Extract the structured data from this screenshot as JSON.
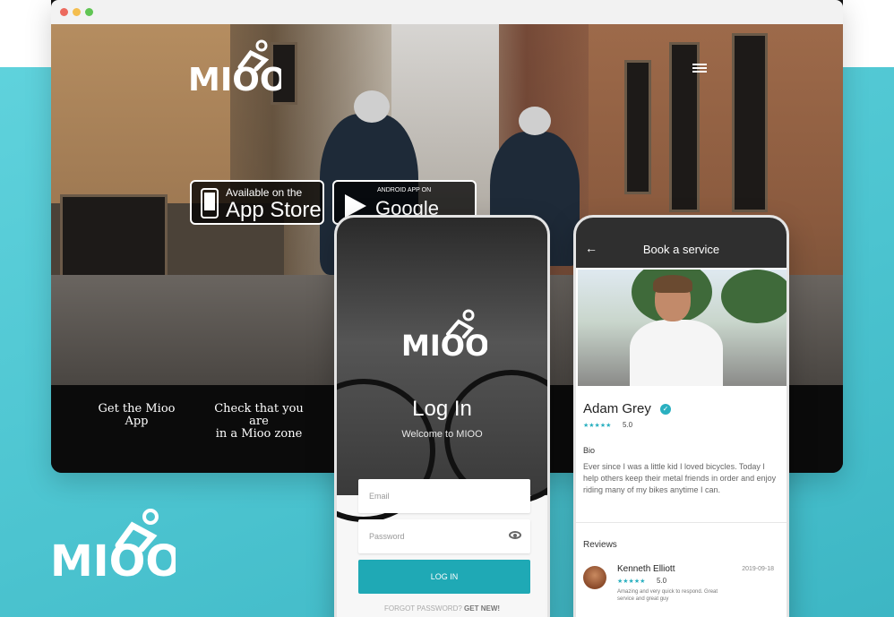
{
  "brand": {
    "name": "MIOO",
    "accent": "#1fa9b5",
    "teal_bg": "#4cc4d0"
  },
  "hero": {
    "badges": {
      "appstore_top": "Available on the",
      "appstore_bottom": "App Store",
      "gplay_top": "ANDROID APP ON",
      "gplay_bottom": "Google Play"
    },
    "footer": {
      "link1": "Get the Mioo App",
      "link2_line1": "Check that you are",
      "link2_line2": "in a Mioo zone"
    }
  },
  "login": {
    "title": "Log In",
    "subtitle": "Welcome to MIOO",
    "email_placeholder": "Email",
    "password_placeholder": "Password",
    "button": "LOG IN",
    "forgot": "FORGOT PASSWORD?",
    "get_new": "GET NEW!"
  },
  "booking": {
    "header_title": "Book a service",
    "name": "Adam Grey",
    "stars": "★★★★★",
    "rating": "5.0",
    "bio_label": "Bio",
    "bio": "Ever since I was a little kid I loved bicycles. Today I help others keep their metal friends in order and enjoy riding many of my bikes anytime I can.",
    "reviews_label": "Reviews",
    "review": {
      "name": "Kenneth Elliott",
      "date": "2019-09-18",
      "stars": "★★★★★",
      "rating": "5.0",
      "text": "Amazing and very quick to respond. Great service and great guy"
    }
  }
}
